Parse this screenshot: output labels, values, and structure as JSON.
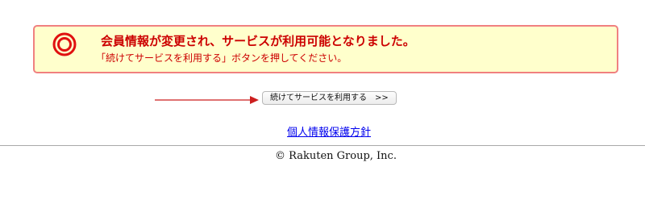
{
  "notice": {
    "icon": "circle-ok-icon",
    "title": "会員情報が変更され、サービスが利用可能となりました。",
    "message": "「続けてサービスを利用する」ボタンを押してください。",
    "accent_color": "#cc0000",
    "background_color": "#ffffcc",
    "border_color": "#f08080"
  },
  "action": {
    "arrow_icon": "right-arrow-icon",
    "continue_label": "続けてサービスを利用する　>>"
  },
  "footer": {
    "privacy_link": "個人情報保護方針",
    "copyright": "© Rakuten Group, Inc."
  }
}
